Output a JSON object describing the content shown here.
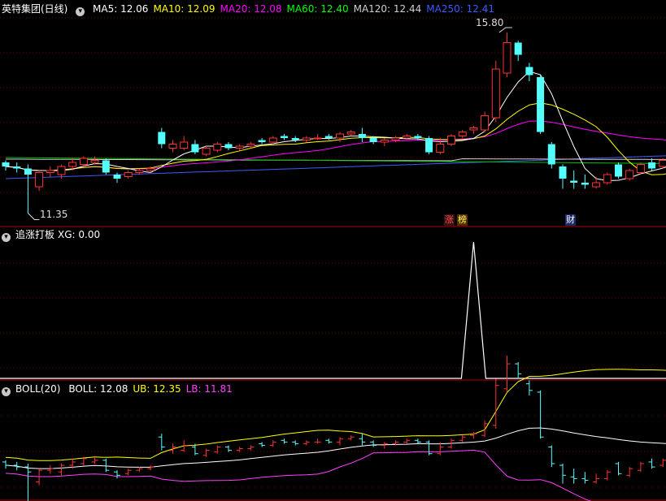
{
  "panel_main": {
    "title": "英特集团(日线)",
    "ma_labels": [
      {
        "text": "MA5: 12.06",
        "color": "#ffffff"
      },
      {
        "text": "MA10: 12.09",
        "color": "#ffff00"
      },
      {
        "text": "MA20: 12.08",
        "color": "#ff00ff"
      },
      {
        "text": "MA60: 12.40",
        "color": "#00ff00"
      },
      {
        "text": "MA120: 12.44",
        "color": "#d0d0d0"
      },
      {
        "text": "MA250: 12.41",
        "color": "#3b5bff"
      }
    ],
    "high_label": "15.80",
    "low_label": "11.35",
    "badge_zhang": "涨",
    "badge_bang": "榜",
    "badge_cai": "财"
  },
  "panel_indicator": {
    "title": "追涨打板",
    "value_text": "XG: 0.00"
  },
  "panel_boll": {
    "title": "BOLL(20)",
    "labels": [
      {
        "text": "BOLL: 12.08",
        "color": "#ffffff"
      },
      {
        "text": "UB: 12.35",
        "color": "#ffff00"
      },
      {
        "text": "LB: 11.81",
        "color": "#ff40ff"
      }
    ]
  },
  "colors": {
    "up": "#ff3333",
    "down": "#54ffff",
    "grid": "#7a0000",
    "divider": "#b00000"
  },
  "chart_data": {
    "type": "candlestick",
    "price_ylim": [
      11.1,
      16.2
    ],
    "candles": [
      [
        12.6,
        12.5,
        12.65,
        12.4
      ],
      [
        12.5,
        12.45,
        12.6,
        12.35
      ],
      [
        12.45,
        12.3,
        12.55,
        11.35
      ],
      [
        12.0,
        12.35,
        12.4,
        11.9
      ],
      [
        12.35,
        12.4,
        12.5,
        12.25
      ],
      [
        12.3,
        12.5,
        12.55,
        12.2
      ],
      [
        12.5,
        12.6,
        12.7,
        12.4
      ],
      [
        12.55,
        12.7,
        12.75,
        12.5
      ],
      [
        12.6,
        12.65,
        12.75,
        12.55
      ],
      [
        12.65,
        12.35,
        12.7,
        12.3
      ],
      [
        12.3,
        12.2,
        12.35,
        12.1
      ],
      [
        12.25,
        12.35,
        12.4,
        12.2
      ],
      [
        12.35,
        12.4,
        12.45,
        12.3
      ],
      [
        12.4,
        12.45,
        12.5,
        12.35
      ],
      [
        13.35,
        13.05,
        13.45,
        12.95
      ],
      [
        12.95,
        13.05,
        13.15,
        12.85
      ],
      [
        12.95,
        13.1,
        13.25,
        12.9
      ],
      [
        13.05,
        12.85,
        13.15,
        12.8
      ],
      [
        12.8,
        12.95,
        13.0,
        12.75
      ],
      [
        12.9,
        13.05,
        13.1,
        12.85
      ],
      [
        13.05,
        12.95,
        13.1,
        12.9
      ],
      [
        12.95,
        13.0,
        13.05,
        12.9
      ],
      [
        13.0,
        13.05,
        13.1,
        12.95
      ],
      [
        13.15,
        13.1,
        13.2,
        13.05
      ],
      [
        13.1,
        13.2,
        13.25,
        13.05
      ],
      [
        13.25,
        13.2,
        13.3,
        13.15
      ],
      [
        13.2,
        13.15,
        13.25,
        13.1
      ],
      [
        13.15,
        13.2,
        13.25,
        13.1
      ],
      [
        13.2,
        13.2,
        13.3,
        13.15
      ],
      [
        13.25,
        13.2,
        13.3,
        13.15
      ],
      [
        13.2,
        13.3,
        13.35,
        13.1
      ],
      [
        13.3,
        13.35,
        13.4,
        13.25
      ],
      [
        13.3,
        13.2,
        13.45,
        13.1
      ],
      [
        13.2,
        13.1,
        13.25,
        13.05
      ],
      [
        13.1,
        13.15,
        13.2,
        13.0
      ],
      [
        13.15,
        13.2,
        13.25,
        13.1
      ],
      [
        13.2,
        13.25,
        13.3,
        13.15
      ],
      [
        13.25,
        13.2,
        13.3,
        13.15
      ],
      [
        13.2,
        12.85,
        13.25,
        12.8
      ],
      [
        12.85,
        13.05,
        13.2,
        12.8
      ],
      [
        13.05,
        13.25,
        13.3,
        13.0
      ],
      [
        13.25,
        13.35,
        13.4,
        13.2
      ],
      [
        13.4,
        13.45,
        13.5,
        13.3
      ],
      [
        13.4,
        13.75,
        13.85,
        13.35
      ],
      [
        13.7,
        14.9,
        15.1,
        13.6
      ],
      [
        14.8,
        15.55,
        15.8,
        14.7
      ],
      [
        15.55,
        15.25,
        15.6,
        15.1
      ],
      [
        14.95,
        14.75,
        15.05,
        14.6
      ],
      [
        14.7,
        13.35,
        14.75,
        13.3
      ],
      [
        13.05,
        12.55,
        13.1,
        12.45
      ],
      [
        12.5,
        12.2,
        12.55,
        11.95
      ],
      [
        12.15,
        12.1,
        12.4,
        11.95
      ],
      [
        12.1,
        12.05,
        12.3,
        11.95
      ],
      [
        12.0,
        12.1,
        12.25,
        11.95
      ],
      [
        12.1,
        12.3,
        12.35,
        12.05
      ],
      [
        12.55,
        12.25,
        12.6,
        12.2
      ],
      [
        12.2,
        12.4,
        12.45,
        12.15
      ],
      [
        12.35,
        12.55,
        12.6,
        12.3
      ],
      [
        12.6,
        12.45,
        12.7,
        12.4
      ],
      [
        12.5,
        12.65,
        12.7,
        12.45
      ],
      [
        12.65,
        12.7,
        12.75,
        12.6
      ],
      [
        12.7,
        12.75,
        12.85,
        12.65
      ],
      [
        12.85,
        12.75,
        12.9,
        12.7
      ],
      [
        12.75,
        12.7,
        12.8,
        12.6
      ],
      [
        12.7,
        12.5,
        12.75,
        12.35
      ]
    ],
    "indicator_series": {
      "name": "XG",
      "spike_at_index": 42,
      "ylim": [
        0,
        1
      ]
    },
    "boll_ylim": [
      11.5,
      14.6
    ]
  }
}
